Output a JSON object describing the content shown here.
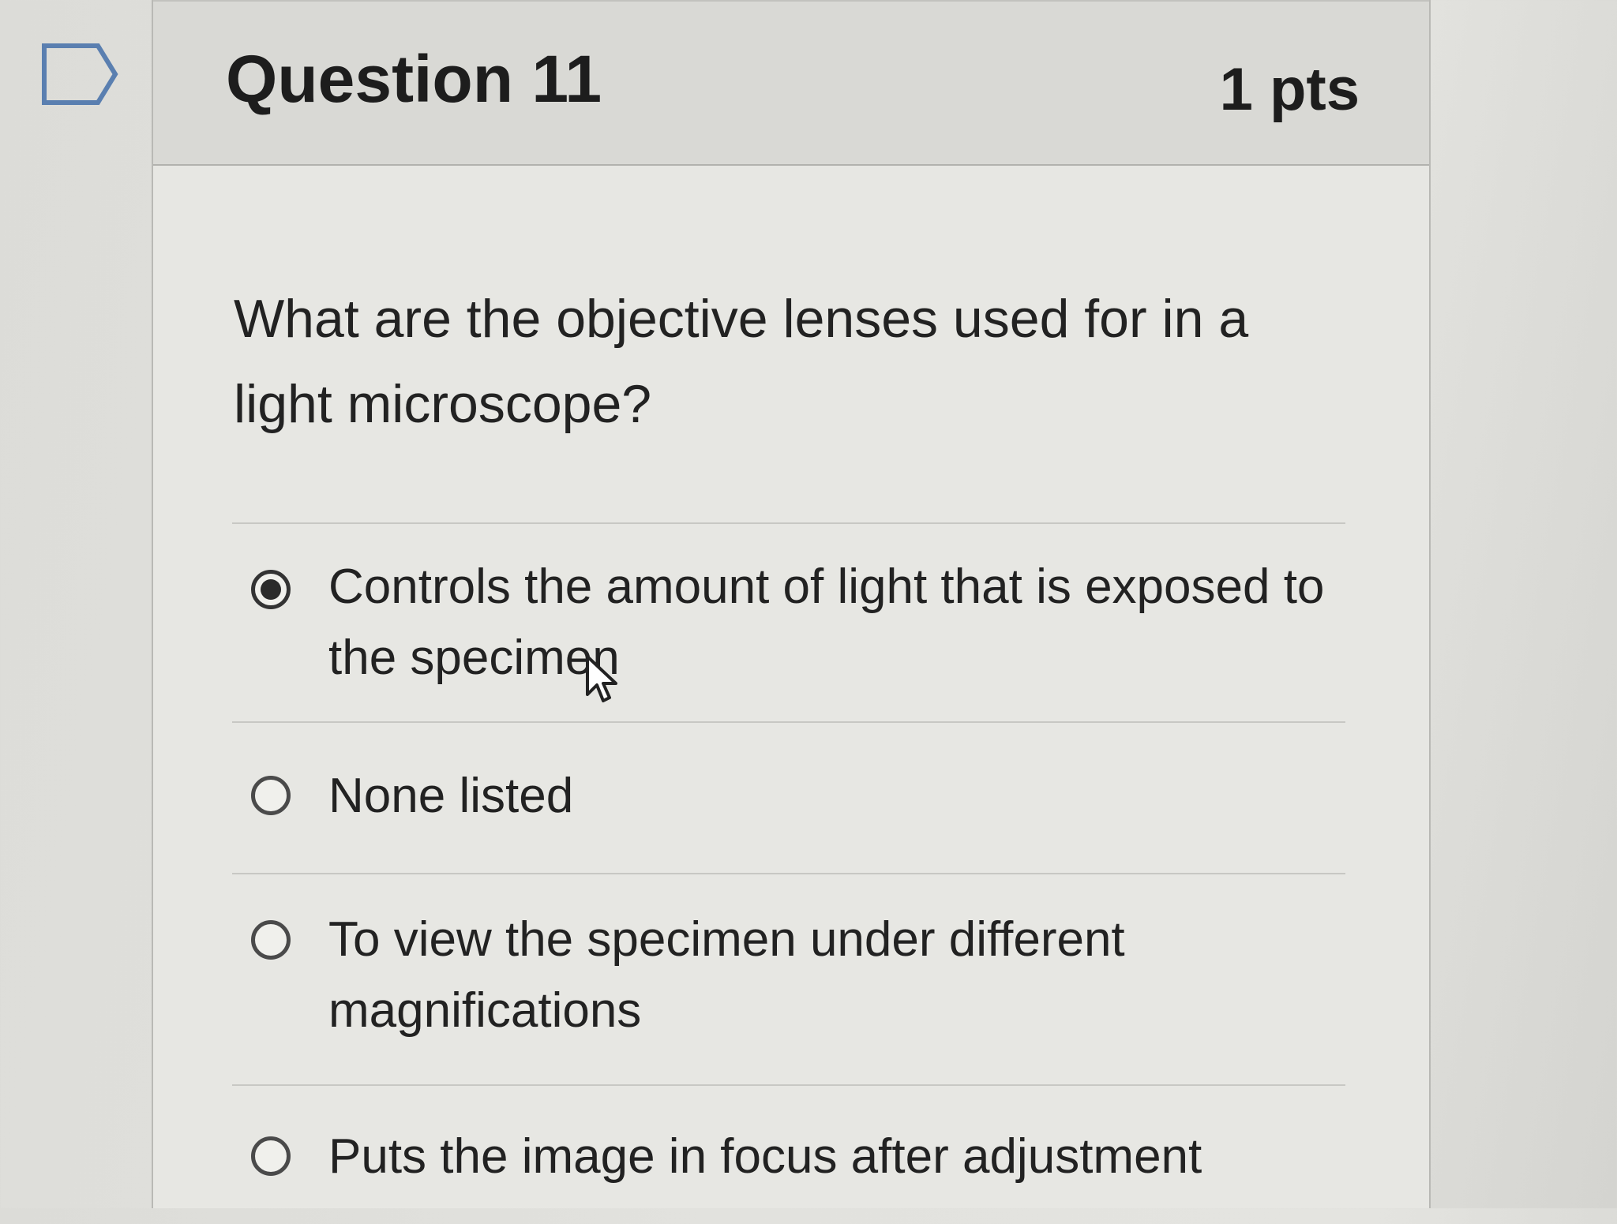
{
  "question": {
    "title": "Question 11",
    "points": "1 pts",
    "text": "What are the objective lenses used for in a light microscope?"
  },
  "answers": [
    {
      "label": "Controls the amount of light that is exposed to the specimen",
      "selected": true
    },
    {
      "label": "None listed",
      "selected": false
    },
    {
      "label": "To view the specimen under different magnifications",
      "selected": false
    },
    {
      "label": "Puts the image in focus after adjustment",
      "selected": false
    }
  ],
  "icons": {
    "flag": "bookmark-flag-icon",
    "cursor": "mouse-pointer-icon"
  },
  "colors": {
    "flag_outline": "#5a7fb0",
    "header_bg": "#d9d9d5",
    "card_bg": "#e7e7e3"
  }
}
